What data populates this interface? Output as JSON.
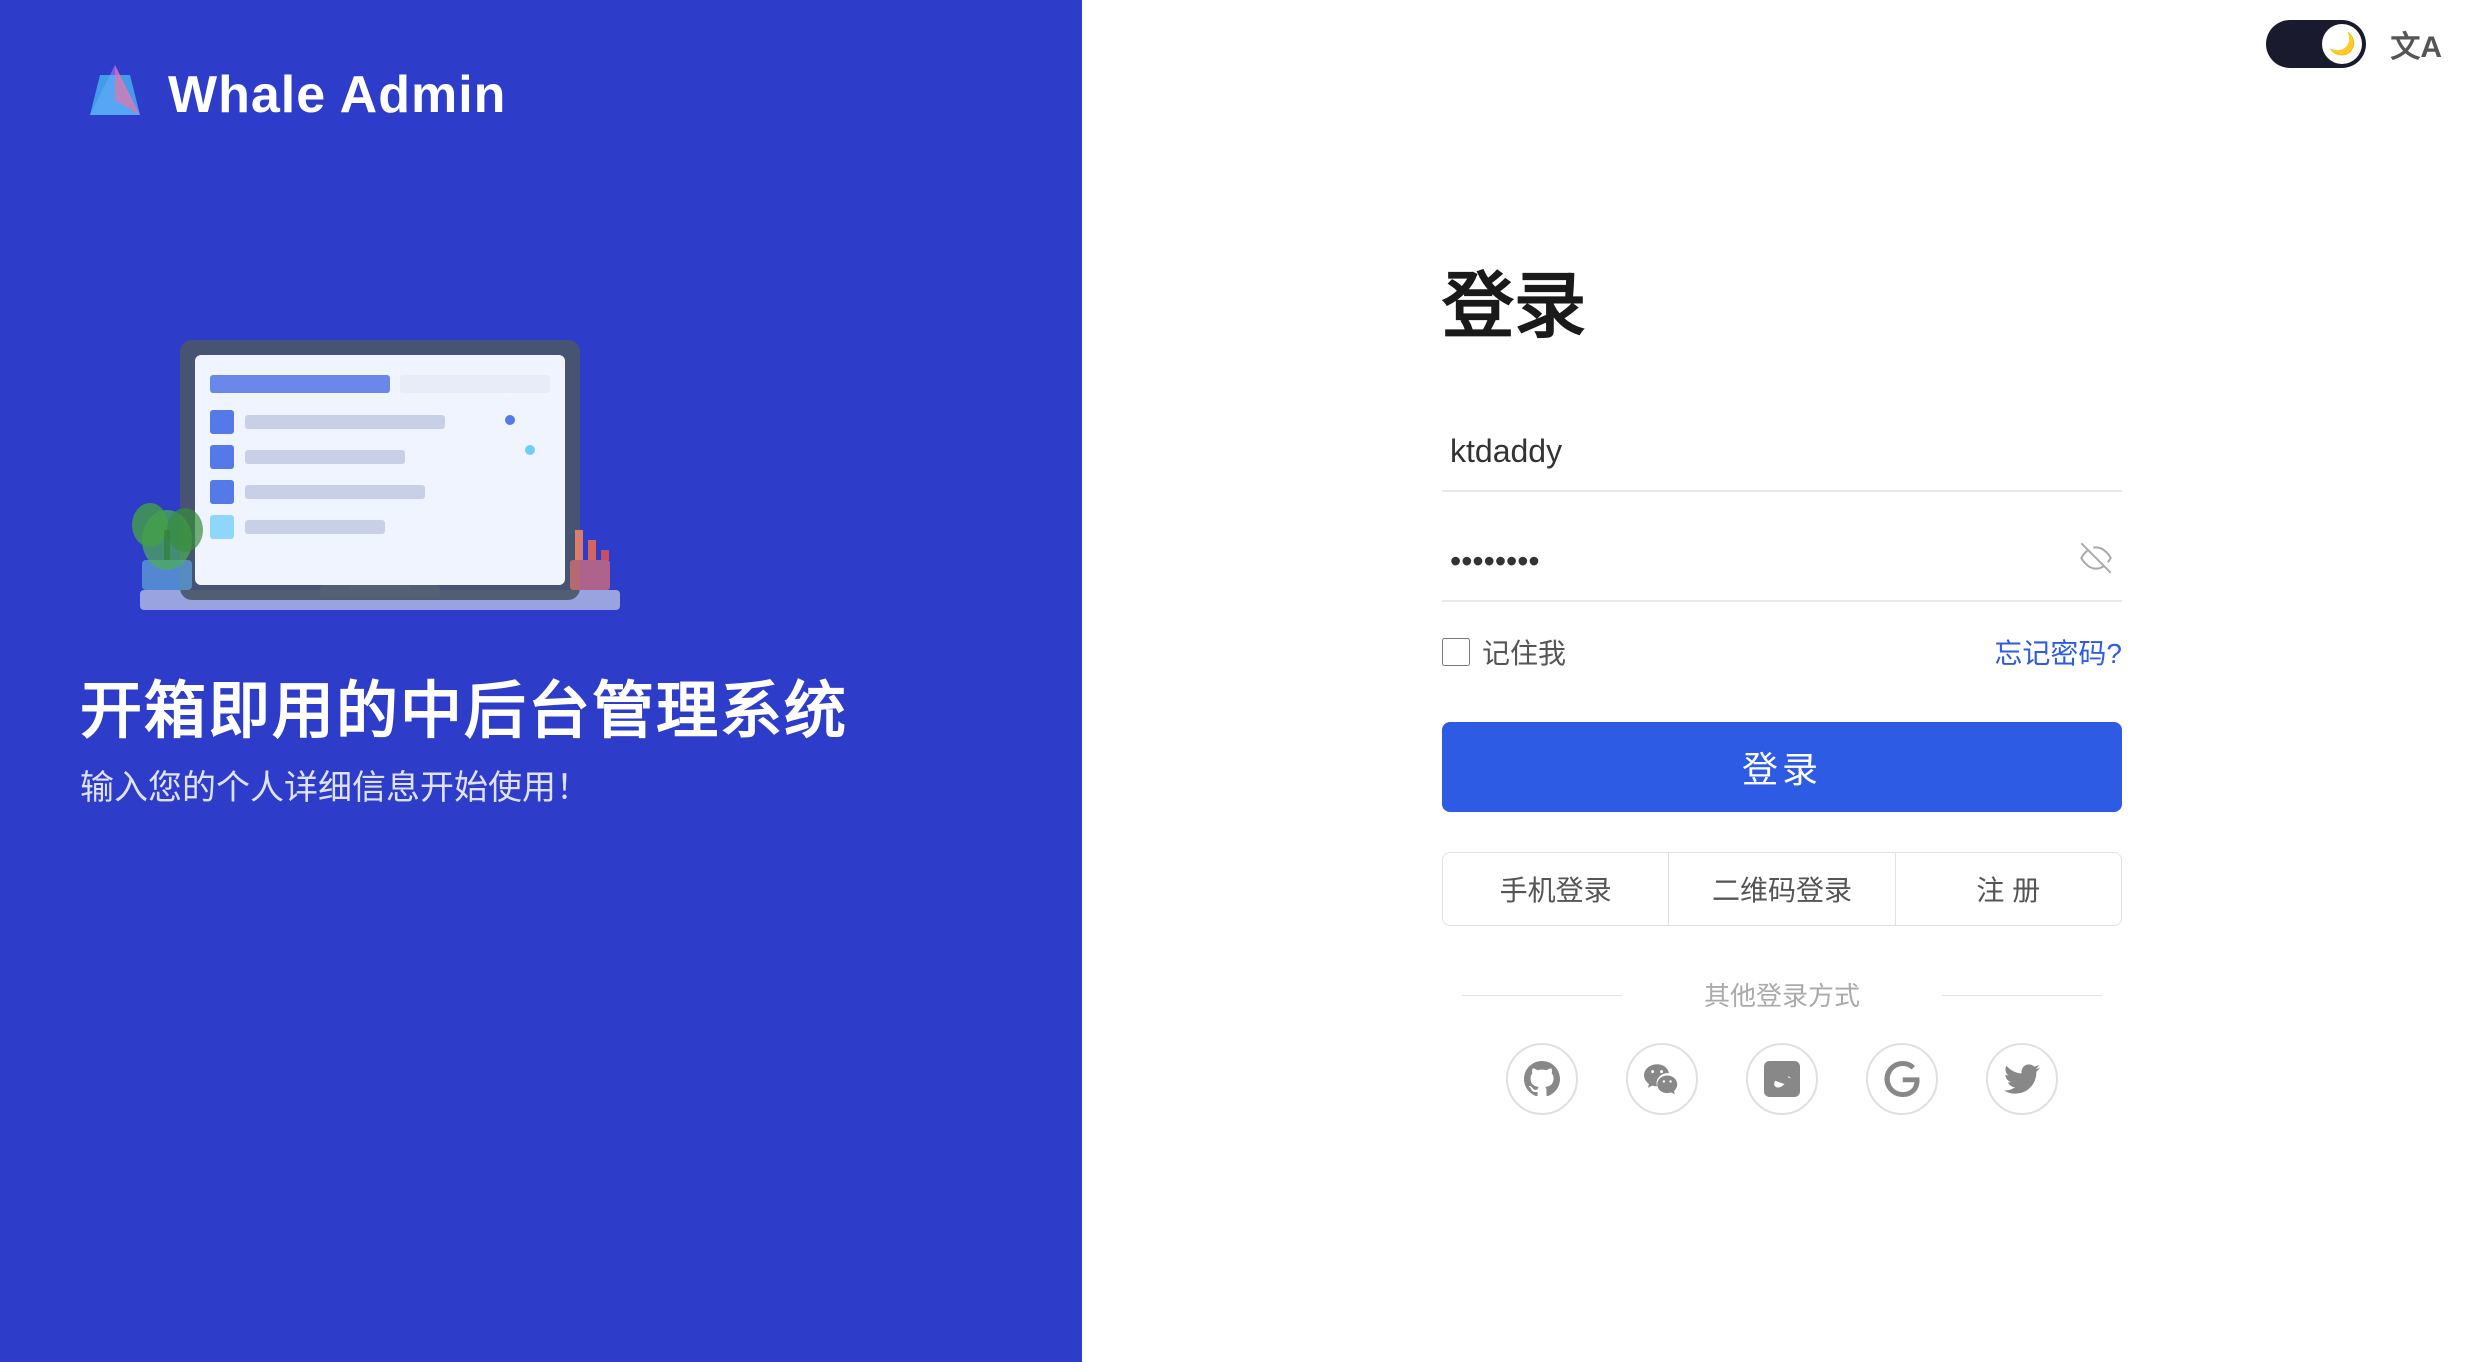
{
  "app": {
    "title": "Whale Admin",
    "logo_alt": "Whale Admin Logo"
  },
  "left": {
    "tagline_main": "开箱即用的中后台管理系统",
    "tagline_sub": "输入您的个人详细信息开始使用！"
  },
  "login_form": {
    "title": "登录",
    "username_placeholder": "ktdaddy",
    "username_value": "ktdaddy",
    "password_placeholder": "••••••••",
    "password_dots": "••••••••",
    "remember_label": "记住我",
    "forgot_label": "忘记密码?",
    "login_btn_label": "登录",
    "alt_tabs": [
      {
        "label": "手机登录"
      },
      {
        "label": "二维码登录"
      },
      {
        "label": "注 册"
      }
    ],
    "other_login_label": "其他登录方式"
  },
  "controls": {
    "dark_mode_icon": "🌙",
    "lang_icon": "文A"
  },
  "social": [
    {
      "name": "github",
      "icon": "⊕"
    },
    {
      "name": "wechat",
      "icon": "💬"
    },
    {
      "name": "alipay",
      "icon": "🅐"
    },
    {
      "name": "google",
      "icon": "G"
    },
    {
      "name": "twitter",
      "icon": "🐦"
    }
  ]
}
